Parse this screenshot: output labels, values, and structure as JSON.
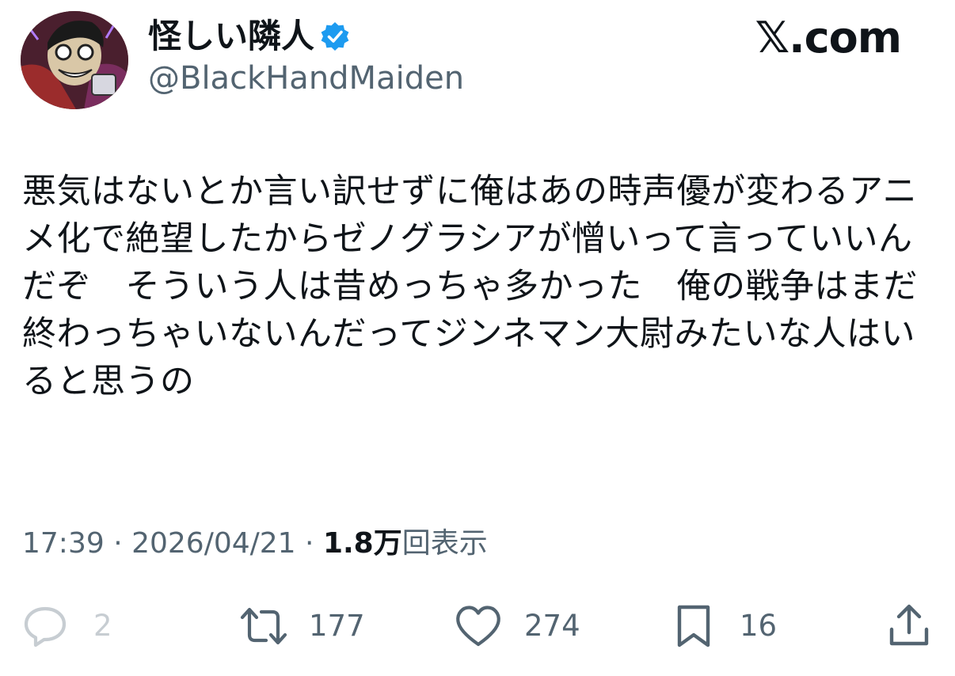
{
  "tweet": {
    "display_name": "怪しい隣人",
    "verified": true,
    "handle": "@BlackHandMaiden",
    "text": "悪気はないとか言い訳せずに俺はあの時声優が変わるアニメ化で絶望したからゼノグラシアが憎いって言っていいんだぞ　そういう人は昔めっちゃ多かった　俺の戦争はまだ終わっちゃいないんだってジンネマン大尉みたいな人はいると思うの",
    "time": "17:39",
    "date": "2026/04/21",
    "separator": " · ",
    "views_count": "1.8万",
    "views_label": "回表示"
  },
  "brand": {
    "label": "𝕏.com"
  },
  "actions": {
    "reply_count": "2",
    "repost_count": "177",
    "like_count": "274",
    "bookmark_count": "16"
  },
  "icons": {
    "verified": "verified-badge-icon",
    "reply": "reply-icon",
    "repost": "repost-icon",
    "like": "heart-icon",
    "bookmark": "bookmark-icon",
    "share": "share-icon"
  },
  "colors": {
    "text": "#0f1419",
    "secondary": "#536471",
    "verified": "#1d9bf0",
    "reply_muted": "#c7cdd2"
  }
}
